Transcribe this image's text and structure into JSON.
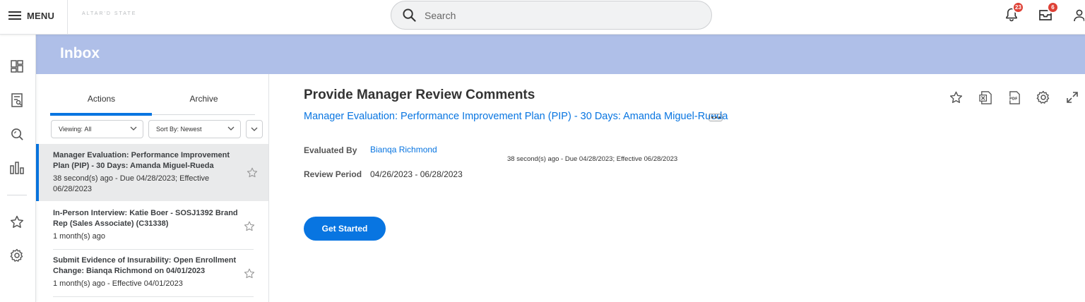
{
  "topbar": {
    "menu_label": "MENU",
    "logo_text": "ALTAR'D STATE",
    "search_placeholder": "Search",
    "notifications_count": "23",
    "inbox_count": "6"
  },
  "header": {
    "title": "Inbox"
  },
  "tabs": [
    {
      "label": "Actions",
      "active": true
    },
    {
      "label": "Archive",
      "active": false
    }
  ],
  "filters": {
    "viewing_label": "Viewing:",
    "viewing_value": "All",
    "sort_label": "Sort By:",
    "sort_value": "Newest"
  },
  "inbox_items": [
    {
      "title": "Manager Evaluation: Performance Improvement Plan (PIP) - 30 Days: Amanda Miguel-Rueda",
      "meta": "38 second(s) ago - Due 04/28/2023; Effective 06/28/2023"
    },
    {
      "title": "In-Person Interview: Katie Boer - SOSJ1392 Brand Rep (Sales Associate) (C31338)",
      "meta": "1 month(s) ago"
    },
    {
      "title": "Submit Evidence of Insurability: Open Enrollment Change: Bianqa Richmond on 04/01/2023",
      "meta": "1 month(s) ago - Effective 04/01/2023"
    }
  ],
  "detail": {
    "title": "Provide Manager Review Comments",
    "subject_link": "Manager Evaluation: Performance Improvement Plan (PIP) - 30 Days: Amanda Miguel-Rueda",
    "evaluated_by_label": "Evaluated By",
    "evaluated_by_value": "Bianqa Richmond",
    "review_period_label": "Review Period",
    "review_period_value": "04/26/2023 - 06/28/2023",
    "due_text": "38 second(s) ago - Due 04/28/2023; Effective 06/28/2023",
    "get_started_label": "Get Started"
  },
  "colors": {
    "accent": "#0875e1",
    "header_band": "#afbfe8",
    "badge": "#de4035"
  }
}
